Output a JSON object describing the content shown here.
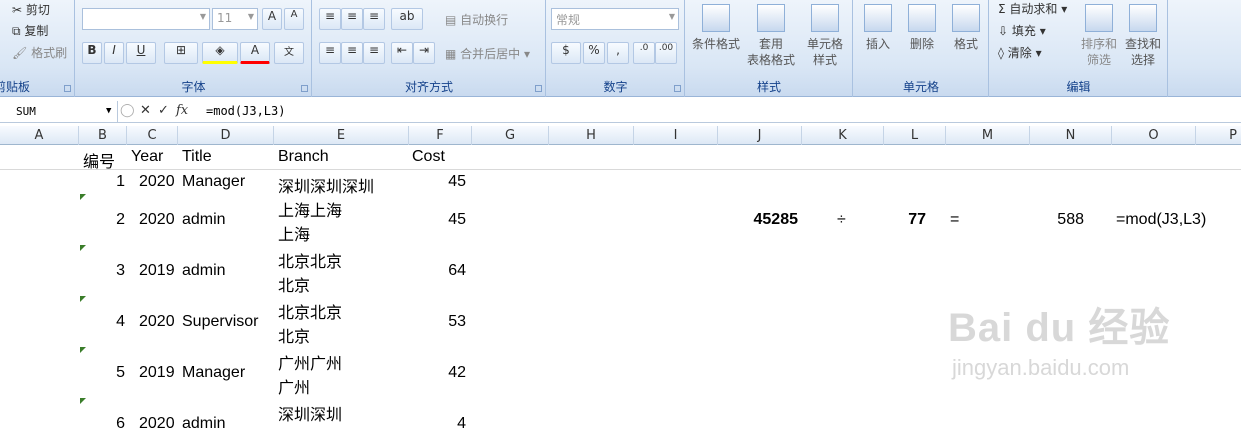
{
  "ribbon": {
    "clipboard": {
      "cut": "剪切",
      "copy": "复制",
      "painter": "格式刷",
      "label": "剪贴板"
    },
    "font": {
      "name": "",
      "size": "11",
      "grow": "A",
      "shrink": "A",
      "bold": "B",
      "italic": "I",
      "underline": "U",
      "label": "字体"
    },
    "align": {
      "wrap": "自动换行",
      "merge": "合并后居中",
      "label": "对齐方式"
    },
    "number": {
      "format": "常规",
      "percent": "%",
      "comma": ",",
      "label": "数字"
    },
    "styles": {
      "cond": "条件格式",
      "table": "套用\n表格格式",
      "cell": "单元格\n样式",
      "label": "样式"
    },
    "cells": {
      "insert": "插入",
      "delete": "删除",
      "format": "格式",
      "label": "单元格"
    },
    "edit": {
      "autosum": "自动求和",
      "fill": "填充",
      "clear": "清除",
      "sort": "排序和\n筛选",
      "find": "查找和\n选择",
      "label": "编辑"
    }
  },
  "formula_bar": {
    "name_box": "SUM",
    "fx": "fx",
    "formula": "=mod(J3,L3)"
  },
  "columns": [
    "A",
    "B",
    "C",
    "D",
    "E",
    "F",
    "G",
    "H",
    "I",
    "J",
    "K",
    "L",
    "M",
    "N",
    "O",
    "P"
  ],
  "header_row": {
    "b": "编号",
    "c": "Year",
    "d": "Title",
    "e": "Branch",
    "f": "Cost"
  },
  "rows": [
    {
      "b": "1",
      "c": "2020",
      "d": "Manager",
      "e1": "深圳深圳深圳",
      "e2": "",
      "f": "45"
    },
    {
      "b": "2",
      "c": "2020",
      "d": "admin",
      "e1": "上海上海",
      "e2": "上海",
      "f": "45"
    },
    {
      "b": "3",
      "c": "2019",
      "d": "admin",
      "e1": "北京北京",
      "e2": "北京",
      "f": "64"
    },
    {
      "b": "4",
      "c": "2020",
      "d": "Supervisor",
      "e1": "北京北京",
      "e2": "北京",
      "f": "53"
    },
    {
      "b": "5",
      "c": "2019",
      "d": "Manager",
      "e1": "广州广州",
      "e2": "广州",
      "f": "42"
    },
    {
      "b": "6",
      "c": "2020",
      "d": "admin",
      "e1": "深圳深圳",
      "e2": "",
      "f": "4"
    }
  ],
  "calc": {
    "j": "45285",
    "k": "÷",
    "l": "77",
    "m": "=",
    "n": "588",
    "o": "=mod(J3,L3)"
  },
  "watermark": {
    "logo": "Bai du 经验",
    "url": "jingyan.baidu.com"
  }
}
